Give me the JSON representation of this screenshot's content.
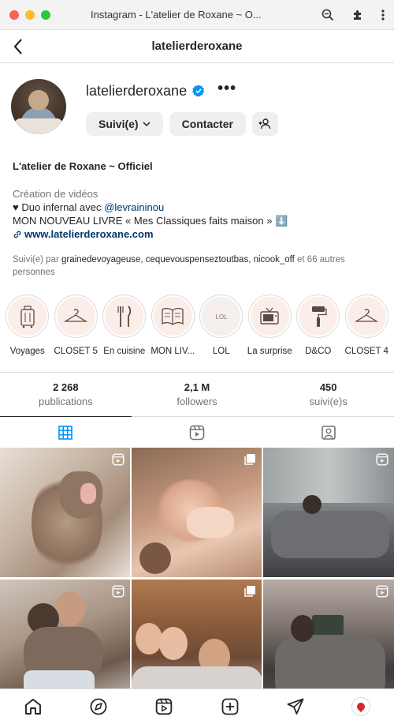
{
  "browser": {
    "title": "Instagram - L'atelier de Roxane ~ O..."
  },
  "topbar": {
    "title": "latelierderoxane"
  },
  "profile": {
    "username": "latelierderoxane",
    "verified": true,
    "follow_button": "Suivi(e)",
    "contact_button": "Contacter"
  },
  "bio": {
    "name": "L'atelier de Roxane ~ Officiel",
    "category": "Création de vidéos",
    "line1_prefix": "♥ Duo infernal avec ",
    "line1_mention": "@levraininou",
    "line2": "MON NOUVEAU LIVRE « Mes Classiques faits maison » ⬇️",
    "link": "www.latelierderoxane.com"
  },
  "followed_by": {
    "prefix": "Suivi(e) par ",
    "users": "grainedevoyageuse, cequevouspenseztoutbas, nicook_off",
    "suffix": " et 66 autres personnes"
  },
  "highlights": [
    {
      "label": "Voyages",
      "icon": "suitcase-icon"
    },
    {
      "label": "CLOSET 5",
      "icon": "hanger-icon"
    },
    {
      "label": "En cuisine",
      "icon": "cutlery-icon"
    },
    {
      "label": "MON LIV...",
      "icon": "book-icon"
    },
    {
      "label": "LOL",
      "icon": "lol-icon"
    },
    {
      "label": "La surprise",
      "icon": "tv-icon"
    },
    {
      "label": "D&CO",
      "icon": "paint-roller-icon"
    },
    {
      "label": "CLOSET 4",
      "icon": "hanger-icon"
    }
  ],
  "stats": [
    {
      "value": "2 268",
      "label": "publications"
    },
    {
      "value": "2,1 M",
      "label": "followers"
    },
    {
      "value": "450",
      "label": "suivi(e)s"
    }
  ],
  "tabs": [
    {
      "name": "posts",
      "icon": "grid-icon",
      "active": true
    },
    {
      "name": "reels",
      "icon": "reels-icon",
      "active": false
    },
    {
      "name": "tagged",
      "icon": "tagged-icon",
      "active": false
    }
  ],
  "posts": [
    {
      "badge": "reel-icon"
    },
    {
      "badge": "carousel-icon"
    },
    {
      "badge": "reel-icon"
    },
    {
      "badge": "reel-icon"
    },
    {
      "badge": "carousel-icon"
    },
    {
      "badge": "reel-icon"
    }
  ],
  "bottom_nav": [
    "home-icon",
    "explore-icon",
    "reels-icon",
    "new-post-icon",
    "direct-icon",
    "profile-avatar"
  ],
  "colors": {
    "accent": "#0095f6",
    "link": "#00376b",
    "muted": "#737373",
    "highlight_bg": "#fbeee8"
  }
}
